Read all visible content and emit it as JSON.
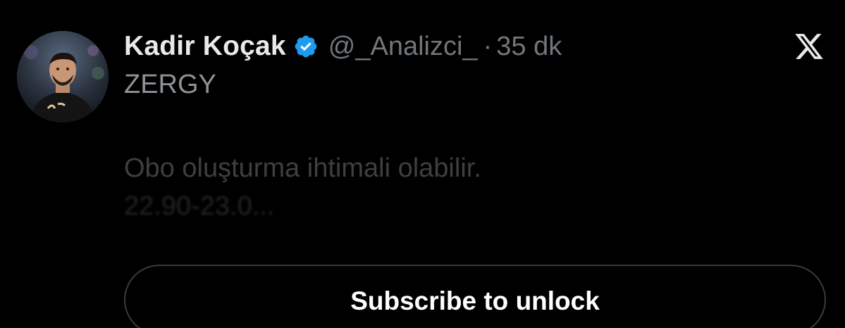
{
  "author": {
    "display_name": "Kadir Koçak",
    "handle": "@_Analizci_",
    "separator": "·",
    "time": "35 dk",
    "verified": true,
    "avatar": "profile-photo"
  },
  "tweet": {
    "title": "ZERGY",
    "locked_line1": "Obo oluşturma ihtimali olabilir.",
    "locked_line2": "22.90-23.0..."
  },
  "icons": {
    "verified_badge": "verified-badge-icon",
    "brand": "x-logo-icon"
  },
  "actions": {
    "subscribe_label": "Subscribe to unlock"
  },
  "colors": {
    "background": "#000000",
    "verified_blue": "#1d9bf0",
    "name_text": "#e7e9ea",
    "muted_text": "#71767b"
  }
}
